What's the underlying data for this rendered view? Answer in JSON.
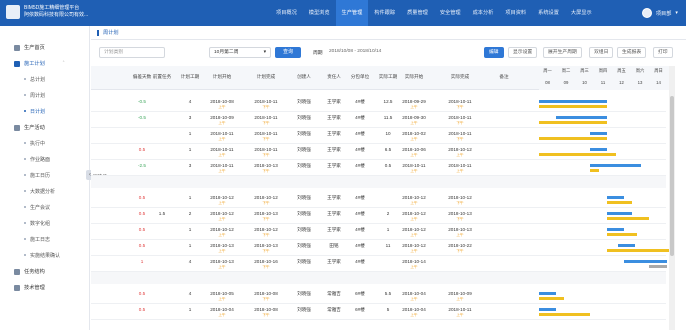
{
  "header": {
    "brand_line1": "BIM5D施工精细管理平台",
    "brand_line2": "阿依数码科技有限公司有效...",
    "nav": [
      "项目概况",
      "模型浏览",
      "生产管理",
      "构件跟踪",
      "质量管理",
      "安全管理",
      "成本分析",
      "项目资料",
      "系统设置",
      "大屏显示"
    ],
    "active_nav": "生产管理",
    "user": "项目部"
  },
  "sidebar": {
    "items": [
      {
        "label": "生产首页",
        "active": false
      },
      {
        "label": "施工计划",
        "active": true
      },
      {
        "label": "生产活动",
        "active": false
      },
      {
        "label": "任务结构",
        "active": false
      },
      {
        "label": "技术管理",
        "active": false
      }
    ],
    "plan_sub": [
      "总计划",
      "周计划",
      "日计划"
    ],
    "activity_sub": [
      "执行中",
      "作业路面",
      "施工日历",
      "大数据分析",
      "生产会议",
      "数字化组",
      "施工日志",
      "实施结果确认"
    ],
    "active_sub": "日计划"
  },
  "tab": {
    "label": "周计划"
  },
  "toolbar": {
    "plan_select_placeholder": "计划类别",
    "week_select": "10月第二周",
    "query_btn": "查询",
    "week_label": "周期",
    "week_range": "2018/10/08 - 2018/10/14",
    "buttons": [
      "编辑",
      "显示设置",
      "展开生产周期",
      "双组日",
      "生成报表",
      "打印"
    ]
  },
  "columns": [
    "偏差天数",
    "前置任务",
    "计划工期",
    "计划开始",
    "计划完成",
    "创建人",
    "责任人",
    "分包单位",
    "实际工期",
    "实际开始",
    "实际完成",
    "备注"
  ],
  "gantt": {
    "days": [
      "周一",
      "周二",
      "周三",
      "周四",
      "周五",
      "周六",
      "周日"
    ],
    "dates": [
      "08",
      "09",
      "10",
      "11",
      "12",
      "13",
      "14"
    ]
  },
  "group_label": "剧情楼",
  "rows": [
    {
      "dev": "-0.5",
      "dev_color": "green",
      "pred": "",
      "dur": "4",
      "ps": "2018-10-08",
      "pe": "2018-10-11",
      "ps_sub": "上午",
      "pe_sub": "下午",
      "creator": "刘晓强",
      "owner": "王学家",
      "sub": "4#楼",
      "adur": "12.5",
      "as": "2018-09-29",
      "ae": "2018-10-11",
      "as_sub": "上午",
      "ae_sub": "下午",
      "bb": [
        0,
        68
      ],
      "yb": [
        0,
        68
      ]
    },
    {
      "dev": "-0.5",
      "dev_color": "green",
      "pred": "",
      "dur": "3",
      "ps": "2018-10-09",
      "pe": "2018-10-11",
      "ps_sub": "上午",
      "pe_sub": "下午",
      "creator": "刘晓强",
      "owner": "王学家",
      "sub": "4#楼",
      "adur": "11.5",
      "as": "2018-09-30",
      "ae": "2018-10-11",
      "as_sub": "上午",
      "ae_sub": "下午",
      "bb": [
        17,
        51
      ],
      "yb": [
        0,
        68
      ]
    },
    {
      "dev": "",
      "dev_color": "",
      "pred": "",
      "dur": "1",
      "ps": "2018-10-11",
      "pe": "2018-10-11",
      "ps_sub": "上午",
      "pe_sub": "下午",
      "creator": "刘晓强",
      "owner": "王学家",
      "sub": "4#楼",
      "adur": "10",
      "as": "2018-10-02",
      "ae": "2018-10-11",
      "as_sub": "上午",
      "ae_sub": "下午",
      "bb": [
        51,
        17
      ],
      "yb": [
        0,
        68
      ]
    },
    {
      "dev": "0.5",
      "dev_color": "red",
      "pred": "",
      "dur": "1",
      "ps": "2018-10-11",
      "pe": "2018-10-11",
      "ps_sub": "上午",
      "pe_sub": "下午",
      "creator": "刘晓强",
      "owner": "王学家",
      "sub": "4#楼",
      "adur": "6.5",
      "as": "2018-10-06",
      "ae": "2018-10-12",
      "as_sub": "上午",
      "ae_sub": "上午",
      "bb": [
        51,
        17
      ],
      "yb": [
        0,
        77
      ]
    },
    {
      "dev": "-2.5",
      "dev_color": "green",
      "pred": "",
      "dur": "3",
      "ps": "2018-10-11",
      "pe": "2018-10-13",
      "ps_sub": "上午",
      "pe_sub": "下午",
      "creator": "刘晓强",
      "owner": "王学家",
      "sub": "4#楼",
      "adur": "0.5",
      "as": "2018-10-11",
      "ae": "2018-10-11",
      "as_sub": "上午",
      "ae_sub": "上午",
      "bb": [
        51,
        51
      ],
      "yb": [
        51,
        9
      ]
    },
    {
      "sep": true
    },
    {
      "dev": "0.5",
      "dev_color": "red",
      "pred": "",
      "dur": "1",
      "ps": "2018-10-12",
      "pe": "2018-10-12",
      "ps_sub": "上午",
      "pe_sub": "下午",
      "creator": "刘晓强",
      "owner": "王学家",
      "sub": "4#楼",
      "adur": "",
      "as": "2018-10-12",
      "ae": "2018-10-12",
      "as_sub": "上午",
      "ae_sub": "下午",
      "bb": [
        68,
        17
      ],
      "yb": [
        68,
        25
      ]
    },
    {
      "dev": "0.5",
      "dev_color": "red",
      "pred": "1.5",
      "dur": "2",
      "ps": "2018-10-12",
      "pe": "2018-10-13",
      "ps_sub": "上午",
      "pe_sub": "下午",
      "creator": "刘晓强",
      "owner": "王学家",
      "sub": "4#楼",
      "adur": "2",
      "as": "2018-10-12",
      "ae": "2018-10-13",
      "as_sub": "上午",
      "ae_sub": "下午",
      "bb": [
        68,
        25
      ],
      "yb": [
        68,
        42
      ]
    },
    {
      "dev": "0.5",
      "dev_color": "red",
      "pred": "",
      "dur": "1",
      "ps": "2018-10-12",
      "pe": "2018-10-12",
      "ps_sub": "上午",
      "pe_sub": "下午",
      "creator": "刘晓强",
      "owner": "王学家",
      "sub": "4#楼",
      "adur": "1",
      "as": "2018-10-12",
      "ae": "2018-10-13",
      "as_sub": "上午",
      "ae_sub": "上午",
      "bb": [
        68,
        17
      ],
      "yb": [
        68,
        30
      ]
    },
    {
      "dev": "0.5",
      "dev_color": "red",
      "pred": "",
      "dur": "1",
      "ps": "2018-10-13",
      "pe": "2018-10-13",
      "ps_sub": "上午",
      "pe_sub": "下午",
      "creator": "刘晓强",
      "owner": "田铭",
      "sub": "4#楼",
      "adur": "11",
      "as": "2018-10-12",
      "ae": "2018-10-22",
      "as_sub": "上午",
      "ae_sub": "下午",
      "bb": [
        79,
        17
      ],
      "yb": [
        68,
        62
      ]
    },
    {
      "dev": "1",
      "dev_color": "red",
      "pred": "",
      "dur": "4",
      "ps": "2018-10-13",
      "pe": "2018-10-16",
      "ps_sub": "上午",
      "pe_sub": "下午",
      "creator": "刘晓强",
      "owner": "王学家",
      "sub": "4#楼",
      "adur": "",
      "as": "2018-10-14",
      "ae": "",
      "as_sub": "上午",
      "ae_sub": "",
      "bb": [
        85,
        43
      ],
      "yb": [
        0,
        0
      ],
      "gb": [
        110,
        18
      ]
    },
    {
      "sep": true
    },
    {
      "dev": "0.5",
      "dev_color": "red",
      "pred": "",
      "dur": "4",
      "ps": "2018-10-05",
      "pe": "2018-10-08",
      "ps_sub": "上午",
      "pe_sub": "下午",
      "creator": "刘晓强",
      "owner": "常雅吉",
      "sub": "6#楼",
      "adur": "5.5",
      "as": "2018-10-04",
      "ae": "2018-10-09",
      "as_sub": "上午",
      "ae_sub": "上午",
      "bb": [
        0,
        17
      ],
      "yb": [
        0,
        25
      ]
    },
    {
      "dev": "0.5",
      "dev_color": "red",
      "pred": "",
      "dur": "1",
      "ps": "2018-10-04",
      "pe": "2018-10-08",
      "ps_sub": "上午",
      "pe_sub": "下午",
      "creator": "刘晓强",
      "owner": "常雅吉",
      "sub": "6#楼",
      "adur": "5",
      "as": "2018-10-04",
      "ae": "2018-10-11",
      "as_sub": "上午",
      "ae_sub": "上午",
      "bb": [
        0,
        17
      ],
      "yb": [
        0,
        51
      ]
    }
  ]
}
